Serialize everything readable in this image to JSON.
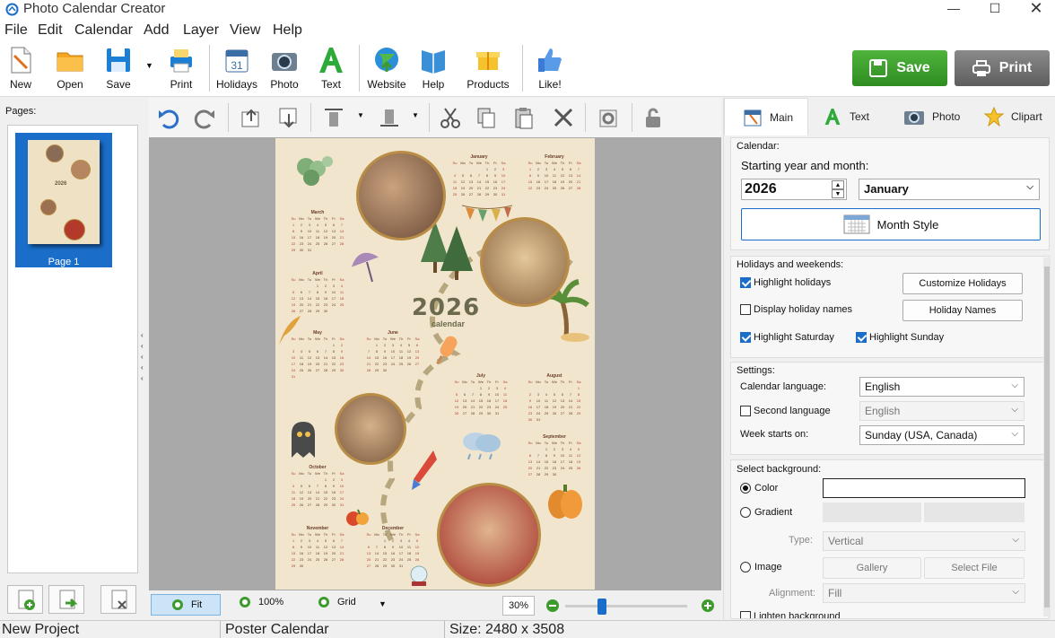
{
  "app": {
    "title": "Photo Calendar Creator"
  },
  "menu": [
    "File",
    "Edit",
    "Calendar",
    "Add",
    "Layer",
    "View",
    "Help"
  ],
  "toolbar": {
    "new": "New",
    "open": "Open",
    "save": "Save",
    "print": "Print",
    "holidays": "Holidays",
    "photo": "Photo",
    "text": "Text",
    "website": "Website",
    "help": "Help",
    "products": "Products",
    "like": "Like!",
    "save_big": "Save",
    "print_big": "Print"
  },
  "pages": {
    "label": "Pages:",
    "page1": "Page 1"
  },
  "canvas": {
    "year": "2026",
    "sub": "calendar",
    "months": [
      "January",
      "February",
      "March",
      "April",
      "May",
      "June",
      "July",
      "August",
      "September",
      "October",
      "November",
      "December"
    ],
    "days": [
      "Su",
      "Mo",
      "Tu",
      "We",
      "Th",
      "Fr",
      "Sa"
    ]
  },
  "bottombar": {
    "fit": "Fit",
    "hundred": "100%",
    "grid": "Grid",
    "zoom": "30%",
    "zoom_level": 0.3
  },
  "tabs": [
    "Main",
    "Text",
    "Photo",
    "Clipart"
  ],
  "calendar_group": {
    "title": "Calendar:",
    "start_label": "Starting year and month:",
    "year": "2026",
    "month": "January",
    "month_style": "Month Style"
  },
  "holidays_group": {
    "title": "Holidays and weekends:",
    "highlight_holidays": "Highlight holidays",
    "display_names": "Display holiday names",
    "highlight_saturday": "Highlight Saturday",
    "highlight_sunday": "Highlight Sunday",
    "customize": "Customize Holidays",
    "holiday_names": "Holiday Names"
  },
  "settings_group": {
    "title": "Settings:",
    "language_label": "Calendar language:",
    "language": "English",
    "second_language": "Second language",
    "second_value": "English",
    "week_label": "Week starts on:",
    "week": "Sunday (USA, Canada)"
  },
  "background_group": {
    "title": "Select background:",
    "color": "Color",
    "gradient": "Gradient",
    "type_label": "Type:",
    "type": "Vertical",
    "image": "Image",
    "gallery": "Gallery",
    "select_file": "Select File",
    "alignment_label": "Alignment:",
    "alignment": "Fill",
    "lighten": "Lighten background"
  },
  "status": {
    "project": "New Project",
    "type": "Poster Calendar",
    "size": "Size: 2480 x 3508"
  },
  "colors": {
    "accent": "#1a6ec9",
    "save": "#3c9b2c",
    "print": "#6d6d6d",
    "poster": "#f1e6cd"
  }
}
